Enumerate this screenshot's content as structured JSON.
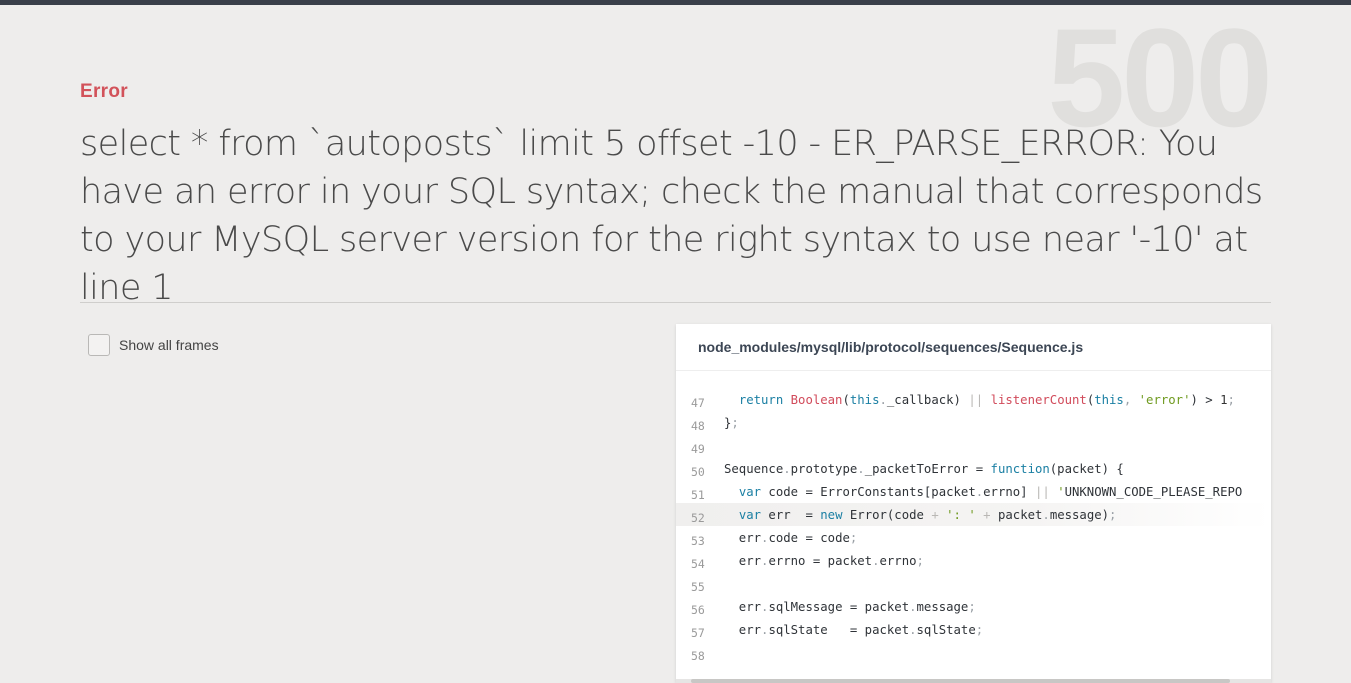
{
  "status_code": "500",
  "error": {
    "label": "Error",
    "message": "select * from `autoposts` limit 5 offset -10 - ER_PARSE_ERROR: You have an error in your SQL syntax; check the manual that corresponds to your MySQL server version for the right syntax to use near '-10' at line 1"
  },
  "frames": {
    "show_all_label": "Show all frames",
    "checked": false
  },
  "code": {
    "file": "node_modules/mysql/lib/protocol/sequences/Sequence.js",
    "highlighted_line": 52,
    "lines": [
      {
        "no": "47",
        "text": "  return Boolean(this._callback) || listenerCount(this, 'error') > 1;"
      },
      {
        "no": "48",
        "text": "};"
      },
      {
        "no": "49",
        "text": ""
      },
      {
        "no": "50",
        "text": "Sequence.prototype._packetToError = function(packet) {"
      },
      {
        "no": "51",
        "text": "  var code = ErrorConstants[packet.errno] || 'UNKNOWN_CODE_PLEASE_REPO"
      },
      {
        "no": "52",
        "text": "  var err  = new Error(code + ': ' + packet.message);"
      },
      {
        "no": "53",
        "text": "  err.code = code;"
      },
      {
        "no": "54",
        "text": "  err.errno = packet.errno;"
      },
      {
        "no": "55",
        "text": ""
      },
      {
        "no": "56",
        "text": "  err.sqlMessage = packet.message;"
      },
      {
        "no": "57",
        "text": "  err.sqlState   = packet.sqlState;"
      },
      {
        "no": "58",
        "text": ""
      }
    ]
  },
  "colors": {
    "accent": "#d2525a",
    "background": "#eeedec",
    "topbar": "#3a3f4a"
  }
}
